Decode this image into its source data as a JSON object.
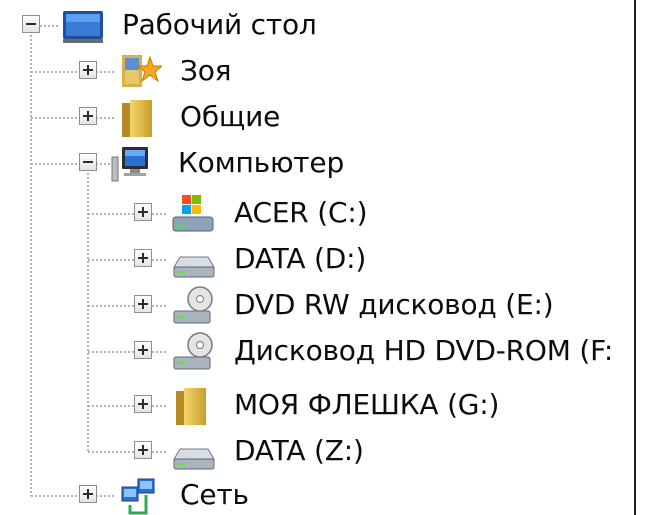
{
  "tree": {
    "items": [
      {
        "label": "Рабочий стол",
        "icon": "desktop-icon",
        "expanded": true,
        "level": 0
      },
      {
        "label": "Зоя",
        "icon": "user-folder-icon",
        "expanded": false,
        "level": 1
      },
      {
        "label": "Общие",
        "icon": "folder-icon",
        "expanded": false,
        "level": 1
      },
      {
        "label": "Компьютер",
        "icon": "computer-icon",
        "expanded": true,
        "level": 1
      },
      {
        "label": "ACER (C:)",
        "icon": "system-drive-icon",
        "expanded": false,
        "level": 2
      },
      {
        "label": "DATA (D:)",
        "icon": "hard-drive-icon",
        "expanded": false,
        "level": 2
      },
      {
        "label": "DVD RW дисковод (E:)",
        "icon": "dvd-drive-icon",
        "expanded": false,
        "level": 2
      },
      {
        "label": "Дисковод HD DVD-ROM (F:",
        "icon": "dvd-drive-icon",
        "expanded": false,
        "level": 2
      },
      {
        "label": "МОЯ ФЛЕШКА (G:)",
        "icon": "folder-icon",
        "expanded": false,
        "level": 2
      },
      {
        "label": "DATA (Z:)",
        "icon": "hard-drive-icon",
        "expanded": false,
        "level": 2
      },
      {
        "label": "Сеть",
        "icon": "network-icon",
        "expanded": false,
        "level": 1
      }
    ]
  },
  "colors": {
    "tree_line": "#9a9a9a",
    "text": "#0c0c0c",
    "expander_border": "#8e8f8f"
  }
}
